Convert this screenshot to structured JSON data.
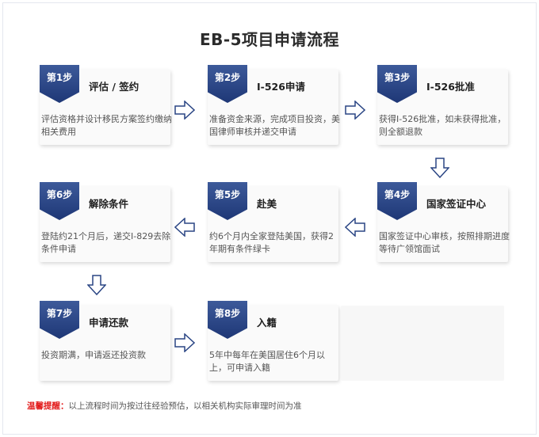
{
  "title": "EB-5项目申请流程",
  "steps": [
    {
      "badge": "第1步",
      "title": "评估 / 签约",
      "desc": "评估资格并设计移民方案签约缴纳相关费用"
    },
    {
      "badge": "第2步",
      "title": "I-526申请",
      "desc": "准备资金来源，完成项目投资，美国律师审核并递交申请"
    },
    {
      "badge": "第3步",
      "title": "I-526批准",
      "desc": "获得I-526批准，如未获得批准，则全额退款"
    },
    {
      "badge": "第4步",
      "title": "国家签证中心",
      "desc": "国家签证中心审核，按照排期进度等待广领馆面试"
    },
    {
      "badge": "第5步",
      "title": "赴美",
      "desc": "约6个月内全家登陆美国，获得2年期有条件绿卡"
    },
    {
      "badge": "第6步",
      "title": "解除条件",
      "desc": "登陆约21个月后，递交I-829去除条件申请"
    },
    {
      "badge": "第7步",
      "title": "申请还款",
      "desc": "投资期满，申请返还投资款"
    },
    {
      "badge": "第8步",
      "title": "入籍",
      "desc": "5年中每年在美国居住6个月以上，可申请入籍"
    }
  ],
  "note": {
    "label": "温馨提醒：",
    "text": "以上流程时间为按过往经验预估，以相关机构实际审理时间为准"
  },
  "colors": {
    "badge": "#2a4584",
    "arrow": "#2a4584",
    "note_label": "#e21a1a"
  }
}
